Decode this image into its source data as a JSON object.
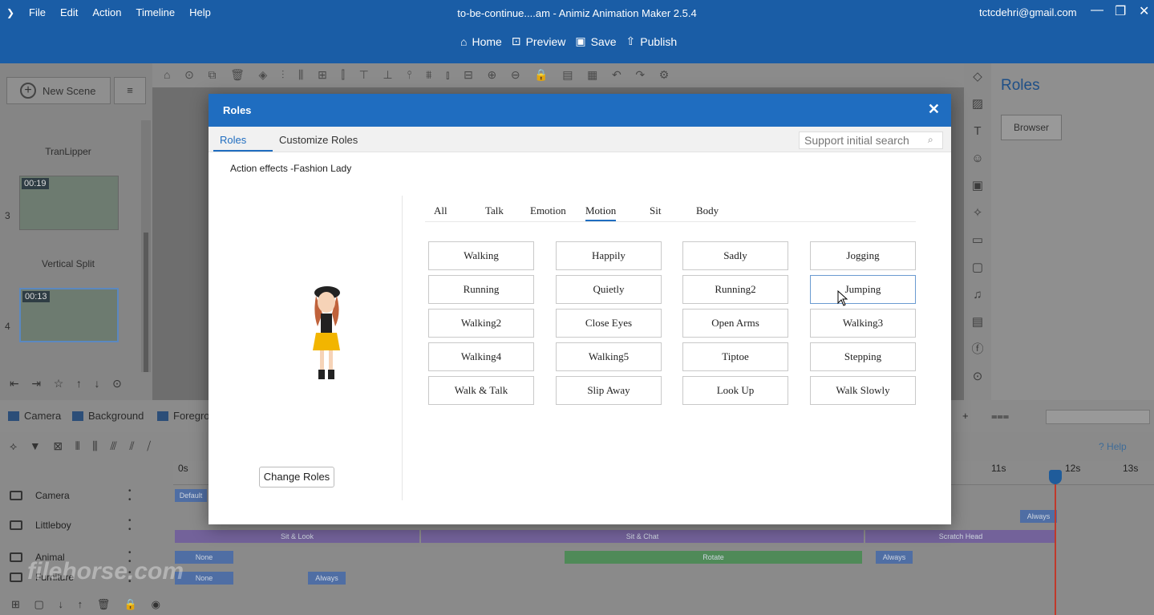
{
  "titlebar": {
    "menu": [
      "File",
      "Edit",
      "Action",
      "Timeline",
      "Help"
    ],
    "title": "to-be-continue....am - Animiz Animation Maker 2.5.4",
    "email": "tctcdehri@gmail.com",
    "actions": [
      "Home",
      "Preview",
      "Save",
      "Publish"
    ]
  },
  "left_panel": {
    "new_scene": "New Scene",
    "scenes": [
      {
        "label": "TranLipper"
      },
      {
        "number": "3",
        "time": "00:19",
        "label": "Vertical Split"
      },
      {
        "number": "4",
        "time": "00:13"
      }
    ]
  },
  "right_panel": {
    "title": "Roles",
    "browser_button": "Browser"
  },
  "layer_bar": {
    "items": [
      "Camera",
      "Background",
      "Foregro"
    ]
  },
  "timeline": {
    "help": "Help",
    "ticks": [
      "0s",
      "11s",
      "12s",
      "13s"
    ],
    "tracks": [
      {
        "name": "Camera"
      },
      {
        "name": "Littleboy"
      },
      {
        "name": "Animal"
      },
      {
        "name": "Furniture"
      }
    ],
    "bars": {
      "default": "Default",
      "none": "None",
      "always": "Always",
      "sit_look": "Sit & Look",
      "sit_chat": "Sit & Chat",
      "scratch_head": "Scratch Head",
      "rotate": "Rotate"
    }
  },
  "watermark": "filehorse.com",
  "dialog": {
    "title": "Roles",
    "tabs": [
      "Roles",
      "Customize Roles"
    ],
    "search_placeholder": "Support initial search",
    "subtitle": "Action effects -Fashion Lady",
    "change_roles": "Change Roles",
    "categories": [
      "All",
      "Talk",
      "Emotion",
      "Motion",
      "Sit",
      "Body"
    ],
    "active_category": "Motion",
    "actions": [
      [
        "Walking",
        "Happily",
        "Sadly",
        "Jogging"
      ],
      [
        "Running",
        "Quietly",
        "Running2",
        "Jumping"
      ],
      [
        "Walking2",
        "Close Eyes",
        "Open Arms",
        "Walking3"
      ],
      [
        "Walking4",
        "Walking5",
        "Tiptoe",
        "Stepping"
      ],
      [
        "Walk & Talk",
        "Slip Away",
        "Look Up",
        "Walk Slowly"
      ]
    ]
  }
}
